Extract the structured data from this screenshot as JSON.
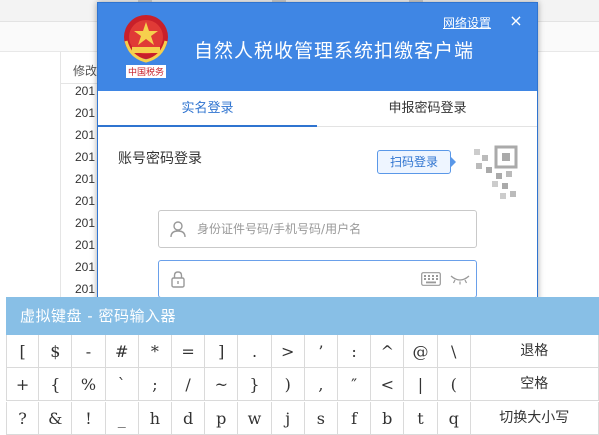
{
  "background": {
    "column_header": "修改",
    "rows": [
      "201",
      "201",
      "201",
      "201",
      "201",
      "201",
      "201",
      "201",
      "201",
      "201",
      "201"
    ]
  },
  "dialog": {
    "title": "自然人税收管理系统扣缴客户端",
    "network_settings": "网络设置",
    "close": "×",
    "emblem_text": "中国税务",
    "tabs": [
      {
        "label": "实名登录",
        "active": true
      },
      {
        "label": "申报密码登录",
        "active": false
      }
    ],
    "section_title": "账号密码登录",
    "scan_login": "扫码登录",
    "username_placeholder": "身份证件号码/手机号码/用户名",
    "password_value": ""
  },
  "keyboard": {
    "title": "虚拟键盘 - 密码输入器",
    "rows": [
      [
        "[",
        "$",
        "-",
        "#",
        "*",
        "=",
        "]",
        ".",
        ">",
        "’",
        ":",
        "^",
        "@",
        "\\"
      ],
      [
        "+",
        "{",
        "%",
        "`",
        ";",
        "/",
        "~",
        "}",
        ")",
        ",",
        "″",
        "<",
        "|",
        "("
      ],
      [
        "?",
        "&",
        "!",
        "_",
        "h",
        "d",
        "p",
        "w",
        "j",
        "s",
        "f",
        "b",
        "t",
        "q"
      ]
    ],
    "function_keys": [
      "退格",
      "空格",
      "切换大小写"
    ]
  },
  "colors": {
    "header_blue": "#3f86e4",
    "accent_blue": "#2f74d0",
    "keyboard_title_bg": "#88bfe6"
  }
}
